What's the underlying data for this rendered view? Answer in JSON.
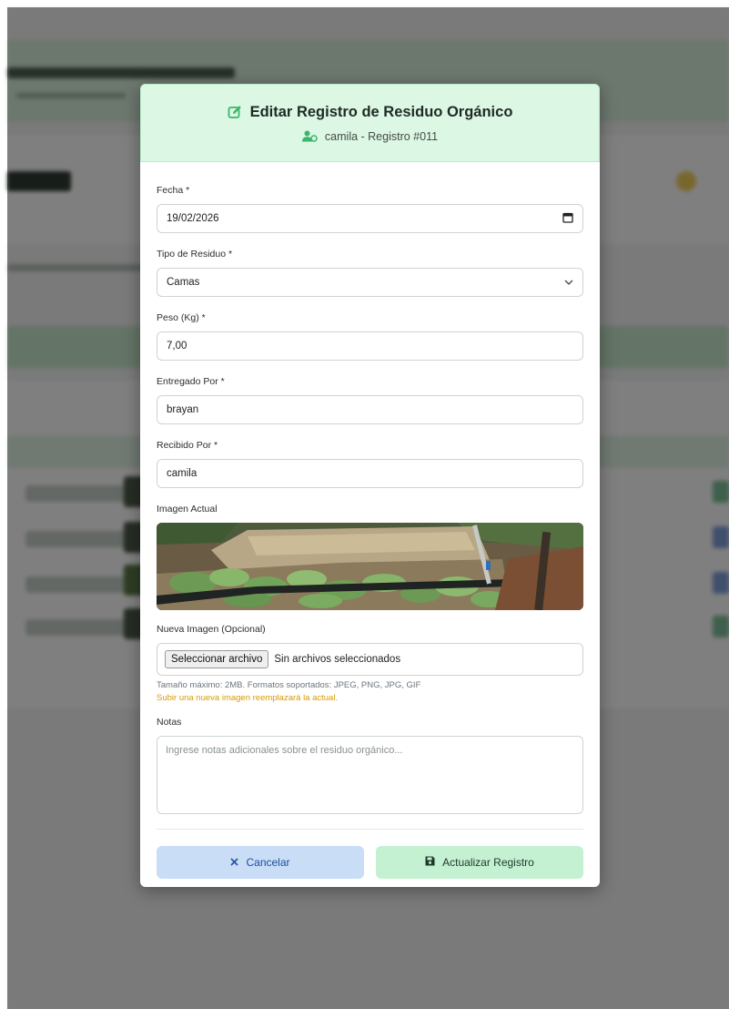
{
  "modal": {
    "title": "Editar Registro de Residuo Orgánico",
    "subtitle": "camila - Registro #011",
    "title_icon": "edit-icon",
    "subtitle_icon": "user-icon",
    "accent_color": "#3bb56b"
  },
  "form": {
    "fecha": {
      "label": "Fecha *",
      "value": "19/02/2026",
      "icon": "calendar-icon"
    },
    "tipo": {
      "label": "Tipo de Residuo *",
      "value": "Camas",
      "icon": "chevron-down-icon"
    },
    "peso": {
      "label": "Peso (Kg) *",
      "value": "7,00"
    },
    "entregado": {
      "label": "Entregado Por *",
      "value": "brayan"
    },
    "recibido": {
      "label": "Recibido Por *",
      "value": "camila"
    },
    "imagen_actual": {
      "label": "Imagen Actual"
    },
    "nueva_imagen": {
      "label": "Nueva Imagen (Opcional)",
      "button": "Seleccionar archivo",
      "status": "Sin archivos seleccionados",
      "hint": "Tamaño máximo: 2MB. Formatos soportados: JPEG, PNG, JPG, GIF",
      "warning": "Subir una nueva imagen reemplazará la actual."
    },
    "notas": {
      "label": "Notas",
      "placeholder": "Ingrese notas adicionales sobre el residuo orgánico..."
    }
  },
  "actions": {
    "cancel": "Cancelar",
    "cancel_icon": "close-icon",
    "save": "Actualizar Registro",
    "save_icon": "save-icon"
  }
}
